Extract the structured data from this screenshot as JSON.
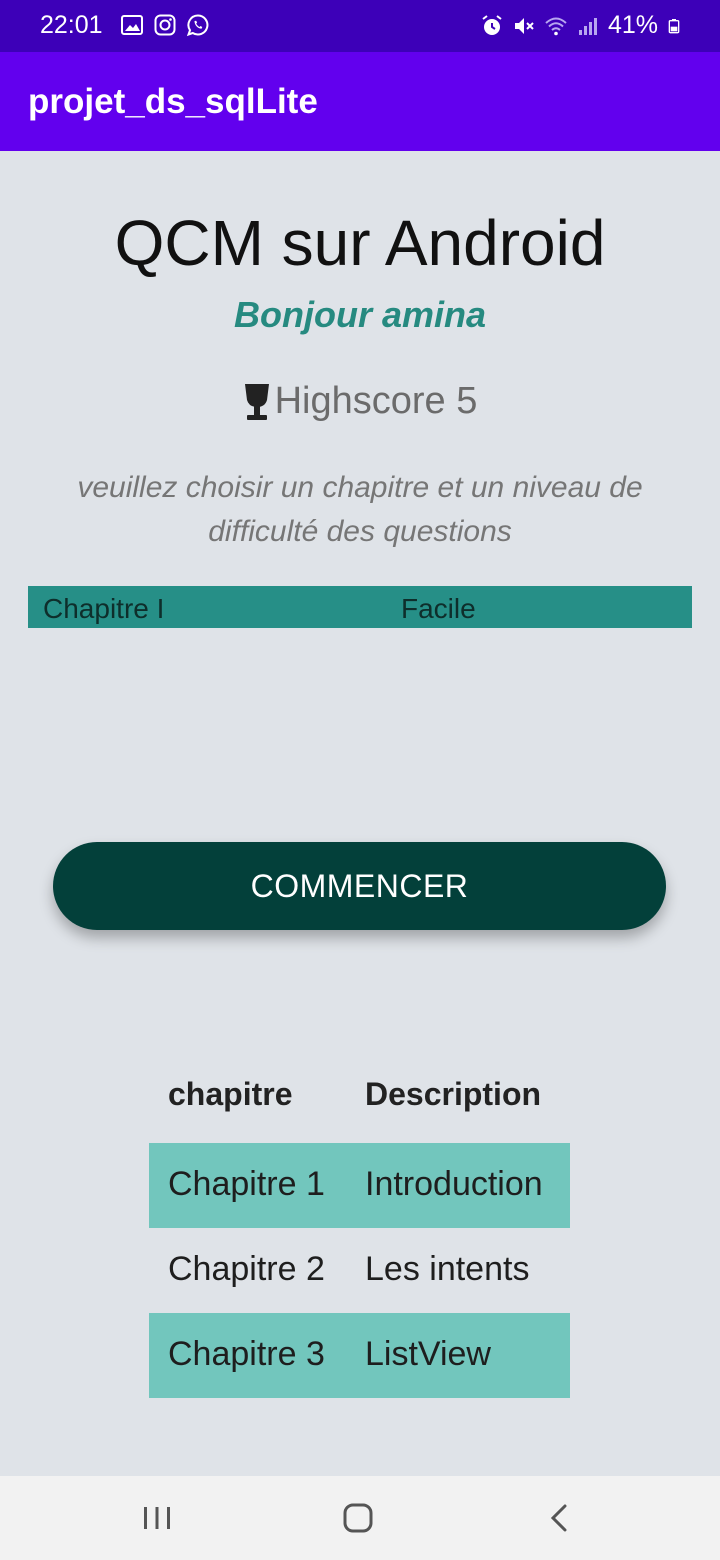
{
  "status_bar": {
    "time": "22:01",
    "battery": "41%",
    "left_icons": [
      "image-icon",
      "instagram-icon",
      "whatsapp-icon"
    ],
    "right_icons": [
      "alarm-icon",
      "mute-icon",
      "wifi-icon",
      "signal-icon",
      "battery-icon"
    ]
  },
  "app_bar": {
    "title": "projet_ds_sqlLite"
  },
  "main": {
    "title": "QCM sur Android",
    "greeting": "Bonjour amina",
    "highscore": "Highscore 5",
    "instructions": "veuillez choisir un chapitre et un niveau de difficulté des questions",
    "chapter_select": {
      "value": "Chapitre I"
    },
    "difficulty_select": {
      "value": "Facile"
    },
    "start_label": "COMMENCER"
  },
  "table": {
    "headers": [
      "chapitre",
      "Description"
    ],
    "rows": [
      [
        "Chapitre 1",
        "Introduction"
      ],
      [
        "Chapitre 2",
        "Les intents"
      ],
      [
        "Chapitre 3",
        "ListView"
      ]
    ]
  },
  "colors": {
    "status_bar": "#3d00b8",
    "app_bar": "#6200ee",
    "background": "#dfe3e8",
    "greeting": "#268a80",
    "spinner": "#268f87",
    "button": "#03403a",
    "table_stripe": "#72c6bd"
  },
  "nav_bar": {
    "buttons": [
      "recents-icon",
      "home-icon",
      "back-icon"
    ]
  }
}
